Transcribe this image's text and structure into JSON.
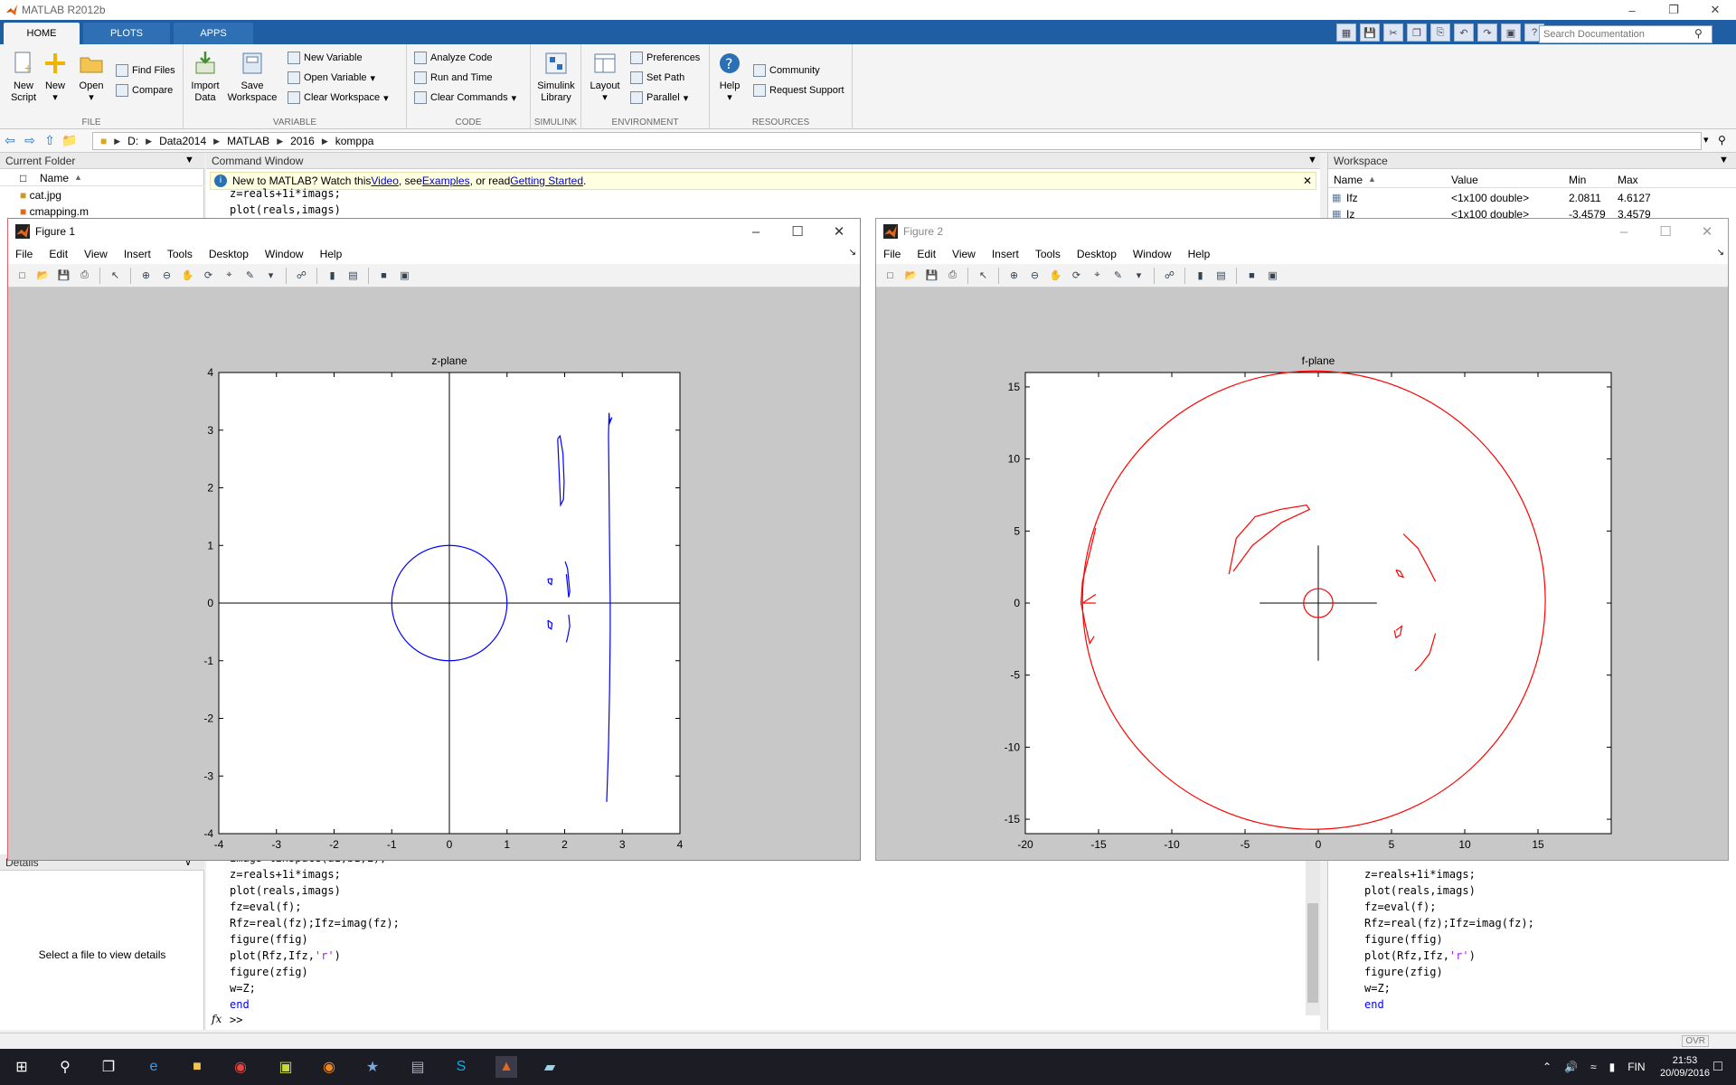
{
  "app": {
    "window_title": "MATLAB R2012b"
  },
  "tabs": [
    {
      "label": "HOME",
      "active": true
    },
    {
      "label": "PLOTS",
      "active": false
    },
    {
      "label": "APPS",
      "active": false
    }
  ],
  "doc_search": {
    "placeholder": "Search Documentation"
  },
  "ribbon": {
    "file": {
      "group_label": "FILE",
      "new_script": "New\nScript",
      "new": "New",
      "open": "Open",
      "find_files": "Find Files",
      "compare": "Compare"
    },
    "variable": {
      "group_label": "VARIABLE",
      "import_data": "Import\nData",
      "save_workspace": "Save\nWorkspace",
      "new_variable": "New Variable",
      "open_variable": "Open Variable",
      "clear_workspace": "Clear Workspace"
    },
    "code": {
      "group_label": "CODE",
      "analyze_code": "Analyze Code",
      "run_and_time": "Run and Time",
      "clear_commands": "Clear Commands"
    },
    "simulink": {
      "group_label": "SIMULINK",
      "library": "Simulink\nLibrary"
    },
    "environment": {
      "group_label": "ENVIRONMENT",
      "layout": "Layout",
      "preferences": "Preferences",
      "set_path": "Set Path",
      "parallel": "Parallel"
    },
    "resources": {
      "group_label": "RESOURCES",
      "help": "Help",
      "community": "Community",
      "request_support": "Request Support"
    }
  },
  "address": {
    "crumbs": [
      "D:",
      "Data2014",
      "MATLAB",
      "2016",
      "komppa"
    ]
  },
  "current_folder": {
    "header": "Current Folder",
    "col_name": "Name",
    "files": [
      {
        "name": "cat.jpg",
        "type": "image"
      },
      {
        "name": "cmapping.m",
        "type": "mfile"
      }
    ],
    "details_header": "Details",
    "details_text": "Select a file to view details"
  },
  "command_window": {
    "header": "Command Window",
    "banner": {
      "prefix": "New to MATLAB? Watch this ",
      "video": "Video",
      "mid1": ", see ",
      "examples": "Examples",
      "mid2": ", or read ",
      "getting_started": "Getting Started",
      "suffix": "."
    },
    "top_lines": [
      "z=reals+1i*imags;",
      "plot(reals,imags)"
    ],
    "bottom_lines": [
      {
        "text": "imags=linspace(a1,b1,L);",
        "kind": "plain"
      },
      {
        "text": "z=reals+1i*imags;",
        "kind": "plain"
      },
      {
        "text": "plot(reals,imags)",
        "kind": "plain"
      },
      {
        "text": "fz=eval(f);",
        "kind": "plain"
      },
      {
        "text": "Rfz=real(fz);Ifz=imag(fz);",
        "kind": "plain"
      },
      {
        "text": "figure(ffig)",
        "kind": "plain"
      },
      {
        "pre": "plot(Rfz,Ifz,",
        "str": "'r'",
        "post": ")",
        "kind": "str"
      },
      {
        "text": "figure(zfig)",
        "kind": "plain"
      },
      {
        "text": "w=Z;",
        "kind": "plain"
      },
      {
        "text": "end",
        "kind": "kw"
      }
    ],
    "prompt": ">>"
  },
  "workspace": {
    "header": "Workspace",
    "columns": [
      "Name",
      "Value",
      "Min",
      "Max"
    ],
    "rows": [
      {
        "name": "Ifz",
        "value": "<1x100 double>",
        "min": "2.0811",
        "max": "4.6127"
      },
      {
        "name": "Iz",
        "value": "<1x100 double>",
        "min": "-3.4579",
        "max": "3.4579"
      }
    ],
    "bottom_lines": [
      {
        "text": "z=reals+1i*imags;",
        "kind": "plain"
      },
      {
        "text": "plot(reals,imags)",
        "kind": "plain"
      },
      {
        "text": "fz=eval(f);",
        "kind": "plain"
      },
      {
        "text": "Rfz=real(fz);Ifz=imag(fz);",
        "kind": "plain"
      },
      {
        "text": "figure(ffig)",
        "kind": "plain"
      },
      {
        "pre": "plot(Rfz,Ifz,",
        "str": "'r'",
        "post": ")",
        "kind": "str"
      },
      {
        "text": "figure(zfig)",
        "kind": "plain"
      },
      {
        "text": "w=Z;",
        "kind": "plain"
      },
      {
        "text": "end",
        "kind": "kw"
      }
    ]
  },
  "figure_menu": [
    "File",
    "Edit",
    "View",
    "Insert",
    "Tools",
    "Desktop",
    "Window",
    "Help"
  ],
  "figure1": {
    "title": "Figure 1",
    "chart_data": {
      "type": "line",
      "title": "z-plane",
      "xlim": [
        -4,
        4
      ],
      "ylim": [
        -4,
        4
      ],
      "xticks": [
        "-4",
        "-3",
        "-2",
        "-1",
        "0",
        "1",
        "2",
        "3",
        "4"
      ],
      "yticks": [
        "-4",
        "-3",
        "-2",
        "-1",
        "0",
        "1",
        "2",
        "3",
        "4"
      ],
      "color": "#0000ff",
      "axis_color": "#000000",
      "circle": {
        "cx": 0,
        "cy": 0,
        "r": 1
      },
      "axes_lines": [
        {
          "x": [
            -4,
            4
          ],
          "y": [
            0,
            0
          ]
        },
        {
          "x": [
            0,
            0
          ],
          "y": [
            -4,
            4
          ]
        }
      ],
      "series": [
        {
          "x": [
            1.88,
            1.92,
            1.97,
            1.99,
            1.98,
            1.93,
            1.88
          ],
          "y": [
            2.85,
            2.9,
            2.6,
            2.1,
            1.8,
            1.7,
            2.85
          ]
        },
        {
          "x": [
            1.71,
            1.78,
            1.77,
            1.72,
            1.71
          ],
          "y": [
            0.42,
            0.42,
            0.32,
            0.36,
            0.42
          ]
        },
        {
          "x": [
            2.01,
            2.05,
            2.09,
            2.07,
            2.03
          ],
          "y": [
            0.72,
            0.6,
            0.2,
            0.1,
            0.5
          ]
        },
        {
          "x": [
            1.71,
            1.78,
            1.77,
            1.72,
            1.71
          ],
          "y": [
            -0.3,
            -0.35,
            -0.45,
            -0.42,
            -0.3
          ]
        },
        {
          "x": [
            2.07,
            2.09,
            2.05,
            2.03
          ],
          "y": [
            -0.2,
            -0.4,
            -0.6,
            -0.68
          ]
        },
        {
          "x": [
            2.73,
            2.76,
            2.78,
            2.79,
            2.79,
            2.78,
            2.77,
            2.76,
            2.77,
            2.78,
            2.82,
            2.77
          ],
          "y": [
            -3.45,
            -2.5,
            -1.5,
            -0.5,
            0.0,
            1.0,
            2.0,
            2.9,
            3.3,
            3.15,
            3.22,
            3.1
          ]
        }
      ]
    }
  },
  "figure2": {
    "title": "Figure 2",
    "chart_data": {
      "type": "line",
      "title": "f-plane",
      "xlim": [
        -20,
        20
      ],
      "ylim": [
        -16,
        16
      ],
      "xticks": [
        "-20",
        "-15",
        "-10",
        "-5",
        "0",
        "5",
        "10",
        "15"
      ],
      "yticks": [
        "-15",
        "-10",
        "-5",
        "0",
        "5",
        "10",
        "15"
      ],
      "color": "#ff0000",
      "axis_color": "#000000",
      "circles": [
        {
          "cx": -0.3,
          "cy": 0.2,
          "rx": 15.8,
          "ry": 15.9
        },
        {
          "cx": 0,
          "cy": 0,
          "rx": 1,
          "ry": 1
        }
      ],
      "axes_lines": [
        {
          "x": [
            -4,
            4
          ],
          "y": [
            0,
            0
          ]
        },
        {
          "x": [
            0,
            0
          ],
          "y": [
            -4,
            4
          ]
        }
      ],
      "series": [
        {
          "x": [
            -15.2,
            -15.6,
            -16.1,
            -16.2,
            -15.9,
            -15.6,
            -15.3
          ],
          "y": [
            5.2,
            3.5,
            1.5,
            0.0,
            -1.5,
            -2.8,
            -2.3
          ]
        },
        {
          "x": [
            -16.1,
            -15.2
          ],
          "y": [
            0.0,
            0.6
          ]
        },
        {
          "x": [
            -16.1,
            -15.2
          ],
          "y": [
            0.0,
            0.0
          ]
        },
        {
          "x": [
            -6.1,
            -5.6,
            -4.3,
            -2.6,
            -0.8,
            -0.6,
            -2.5,
            -4.5,
            -5.8
          ],
          "y": [
            2.0,
            4.5,
            6.0,
            6.5,
            6.8,
            6.5,
            5.6,
            4.0,
            2.2
          ]
        },
        {
          "x": [
            5.3,
            5.6,
            5.8,
            5.5,
            5.3
          ],
          "y": [
            2.3,
            2.2,
            1.8,
            1.9,
            2.3
          ]
        },
        {
          "x": [
            5.3,
            5.7,
            5.6,
            5.3,
            5.2
          ],
          "y": [
            -1.9,
            -1.6,
            -2.2,
            -2.4,
            -1.9
          ]
        },
        {
          "x": [
            5.8,
            6.8,
            7.5,
            8.0
          ],
          "y": [
            4.8,
            3.8,
            2.5,
            1.5
          ]
        },
        {
          "x": [
            8.0,
            7.6,
            7.0,
            6.6
          ],
          "y": [
            -2.1,
            -3.5,
            -4.3,
            -4.7
          ]
        }
      ]
    }
  },
  "status": {
    "ovr": "OVR"
  },
  "taskbar": {
    "language": "FIN",
    "time": "21:53",
    "date": "20/09/2016"
  }
}
